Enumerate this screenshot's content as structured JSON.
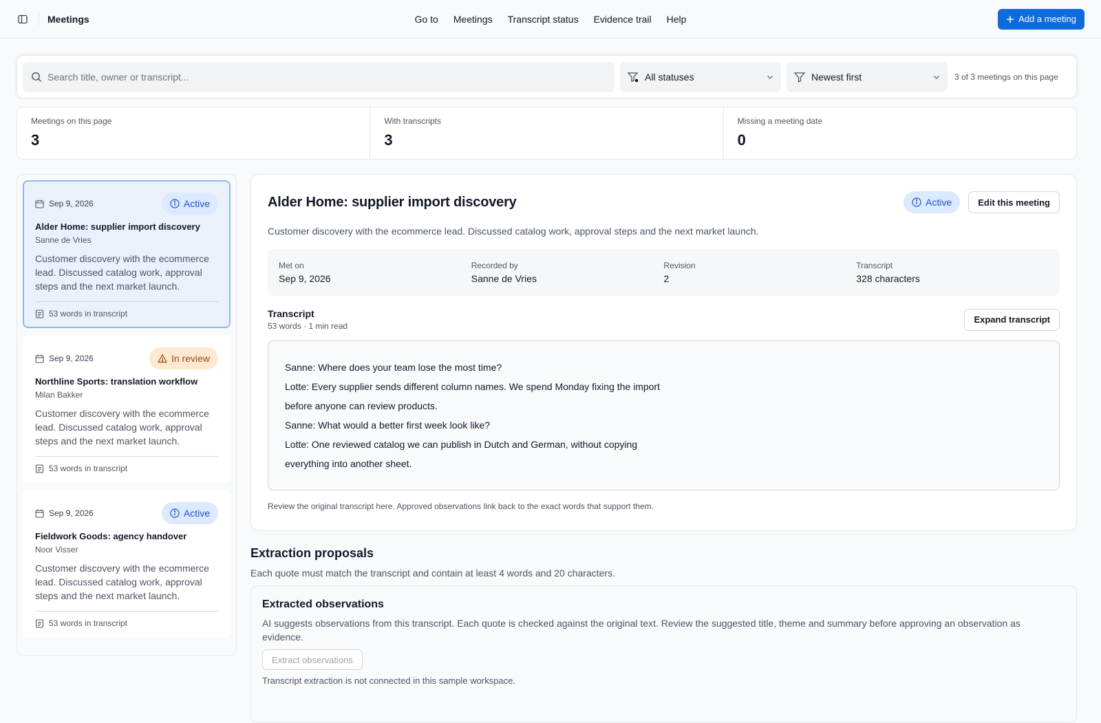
{
  "header": {
    "app_title": "Meetings",
    "nav": [
      "Go to",
      "Meetings",
      "Transcript status",
      "Evidence trail",
      "Help"
    ],
    "add_button": "Add a meeting"
  },
  "filters": {
    "search_placeholder": "Search title, owner or transcript...",
    "status_value": "All statuses",
    "sort_value": "Newest first",
    "count_text": "3 of 3 meetings on this page"
  },
  "stats": [
    {
      "label": "Meetings on this page",
      "value": "3"
    },
    {
      "label": "With transcripts",
      "value": "3"
    },
    {
      "label": "Missing a meeting date",
      "value": "0"
    }
  ],
  "meetings": [
    {
      "date": "Sep 9, 2026",
      "status": "Active",
      "title": "Alder Home: supplier import discovery",
      "owner": "Sanne de Vries",
      "description": "Customer discovery with the ecommerce lead. Discussed catalog work, approval steps and the next market launch.",
      "words": "53 words in transcript",
      "selected": true
    },
    {
      "date": "Sep 9, 2026",
      "status": "In review",
      "title": "Northline Sports: translation workflow",
      "owner": "Milan Bakker",
      "description": "Customer discovery with the ecommerce lead. Discussed catalog work, approval steps and the next market launch.",
      "words": "53 words in transcript",
      "selected": false
    },
    {
      "date": "Sep 9, 2026",
      "status": "Active",
      "title": "Fieldwork Goods: agency handover",
      "owner": "Noor Visser",
      "description": "Customer discovery with the ecommerce lead. Discussed catalog work, approval steps and the next market launch.",
      "words": "53 words in transcript",
      "selected": false
    }
  ],
  "detail": {
    "title": "Alder Home: supplier import discovery",
    "status": "Active",
    "edit_button": "Edit this meeting",
    "description": "Customer discovery with the ecommerce lead. Discussed catalog work, approval steps and the next market launch.",
    "meta": [
      {
        "label": "Met on",
        "value": "Sep 9, 2026"
      },
      {
        "label": "Recorded by",
        "value": "Sanne de Vries"
      },
      {
        "label": "Revision",
        "value": "2"
      },
      {
        "label": "Transcript",
        "value": "328 characters"
      }
    ],
    "transcript_title": "Transcript",
    "transcript_sub": "53 words · 1 min read",
    "expand_button": "Expand transcript",
    "transcript_lines": [
      "Sanne: Where does your team lose the most time?",
      "Lotte: Every supplier sends different column names. We spend Monday fixing the import",
      "before anyone can review products.",
      "Sanne: What would a better first week look like?",
      "Lotte: One reviewed catalog we can publish in Dutch and German, without copying",
      "everything into another sheet."
    ],
    "note": "Review the original transcript here. Approved observations link back to the exact words that support them."
  },
  "extraction": {
    "title": "Extraction proposals",
    "subtitle": "Each quote must match the transcript and contain at least 4 words and 20 characters.",
    "panel_title": "Extracted observations",
    "panel_desc": "AI suggests observations from this transcript. Each quote is checked against the original text. Review the suggested title, theme and summary before approving an observation as evidence.",
    "button": "Extract observations",
    "note": "Transcript extraction is not connected in this sample workspace."
  },
  "colors": {
    "accent": "#0b6bdf",
    "active_badge_bg": "#dbeafe",
    "active_badge_fg": "#1d4ed8",
    "review_badge_bg": "#fde9d2",
    "review_badge_fg": "#9a4a0b",
    "selected_card_bg": "#eaf1fb"
  },
  "icons": {
    "sidebar_toggle": "panel-left-icon",
    "add": "plus-icon",
    "search": "search-icon",
    "status_filter": "filter-icon",
    "sort": "funnel-icon",
    "dropdown": "chevron-down-icon",
    "date": "calendar-icon",
    "words": "document-icon",
    "active": "info-icon",
    "review": "warning-icon"
  }
}
